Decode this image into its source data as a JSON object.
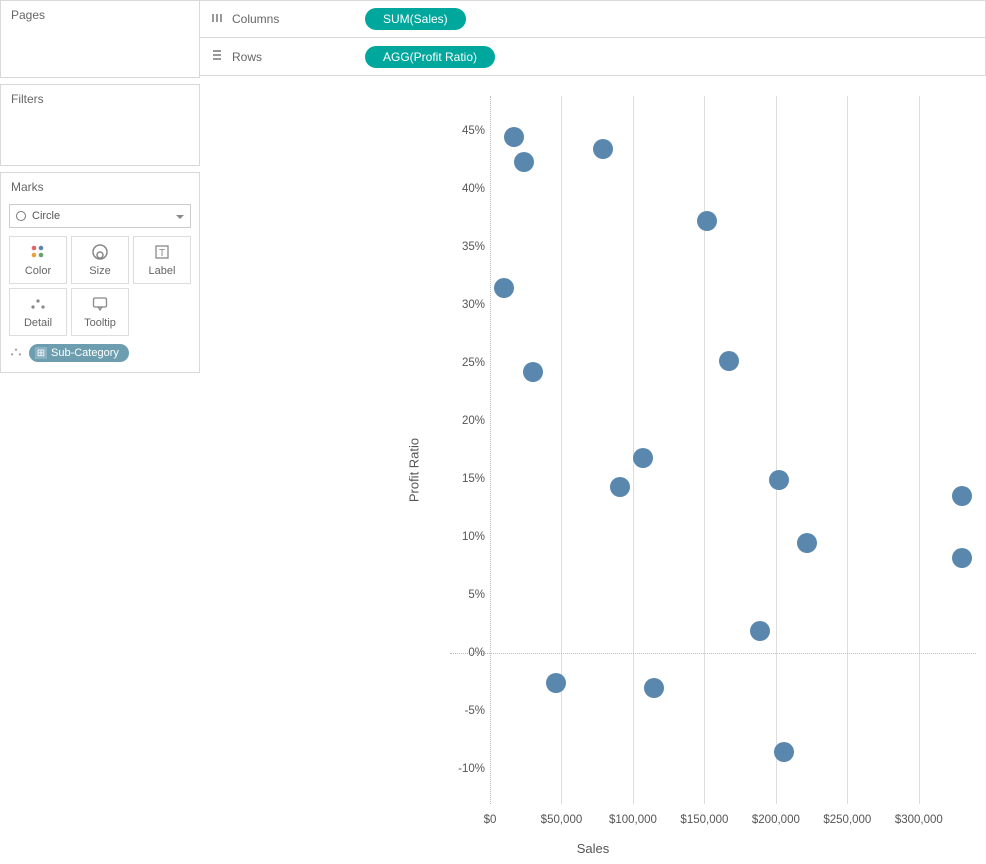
{
  "shelves": {
    "columns_label": "Columns",
    "rows_label": "Rows",
    "columns_pill": "SUM(Sales)",
    "rows_pill": "AGG(Profit Ratio)"
  },
  "cards": {
    "pages": "Pages",
    "filters": "Filters",
    "marks": "Marks"
  },
  "marks": {
    "type": "Circle",
    "buttons": {
      "color": "Color",
      "size": "Size",
      "label": "Label",
      "detail": "Detail",
      "tooltip": "Tooltip"
    },
    "detail_pill": "Sub-Category"
  },
  "axes": {
    "x_title": "Sales",
    "y_title": "Profit Ratio"
  },
  "chart_data": {
    "type": "scatter",
    "xlabel": "Sales",
    "ylabel": "Profit Ratio",
    "xlim": [
      0,
      340000
    ],
    "ylim": [
      -0.13,
      0.48
    ],
    "xticks": [
      0,
      50000,
      100000,
      150000,
      200000,
      250000,
      300000
    ],
    "xtick_labels": [
      "$0",
      "$50,000",
      "$100,000",
      "$150,000",
      "$200,000",
      "$250,000",
      "$300,000"
    ],
    "yticks": [
      -0.1,
      -0.05,
      0,
      0.05,
      0.1,
      0.15,
      0.2,
      0.25,
      0.3,
      0.35,
      0.4,
      0.45
    ],
    "ytick_labels": [
      "-10%",
      "-5%",
      "0%",
      "5%",
      "10%",
      "15%",
      "20%",
      "25%",
      "30%",
      "35%",
      "40%",
      "45%"
    ],
    "series": [
      {
        "name": "Sub-Category",
        "points": [
          {
            "x": 16500,
            "y": 0.445
          },
          {
            "x": 24000,
            "y": 0.423
          },
          {
            "x": 79000,
            "y": 0.434
          },
          {
            "x": 152000,
            "y": 0.372
          },
          {
            "x": 10000,
            "y": 0.315
          },
          {
            "x": 167000,
            "y": 0.252
          },
          {
            "x": 30000,
            "y": 0.242
          },
          {
            "x": 107000,
            "y": 0.168
          },
          {
            "x": 202000,
            "y": 0.149
          },
          {
            "x": 91000,
            "y": 0.143
          },
          {
            "x": 330000,
            "y": 0.135
          },
          {
            "x": 222000,
            "y": 0.095
          },
          {
            "x": 330000,
            "y": 0.082
          },
          {
            "x": 189000,
            "y": 0.019
          },
          {
            "x": 46000,
            "y": -0.026
          },
          {
            "x": 115000,
            "y": -0.03
          },
          {
            "x": 206000,
            "y": -0.085
          }
        ]
      }
    ]
  }
}
